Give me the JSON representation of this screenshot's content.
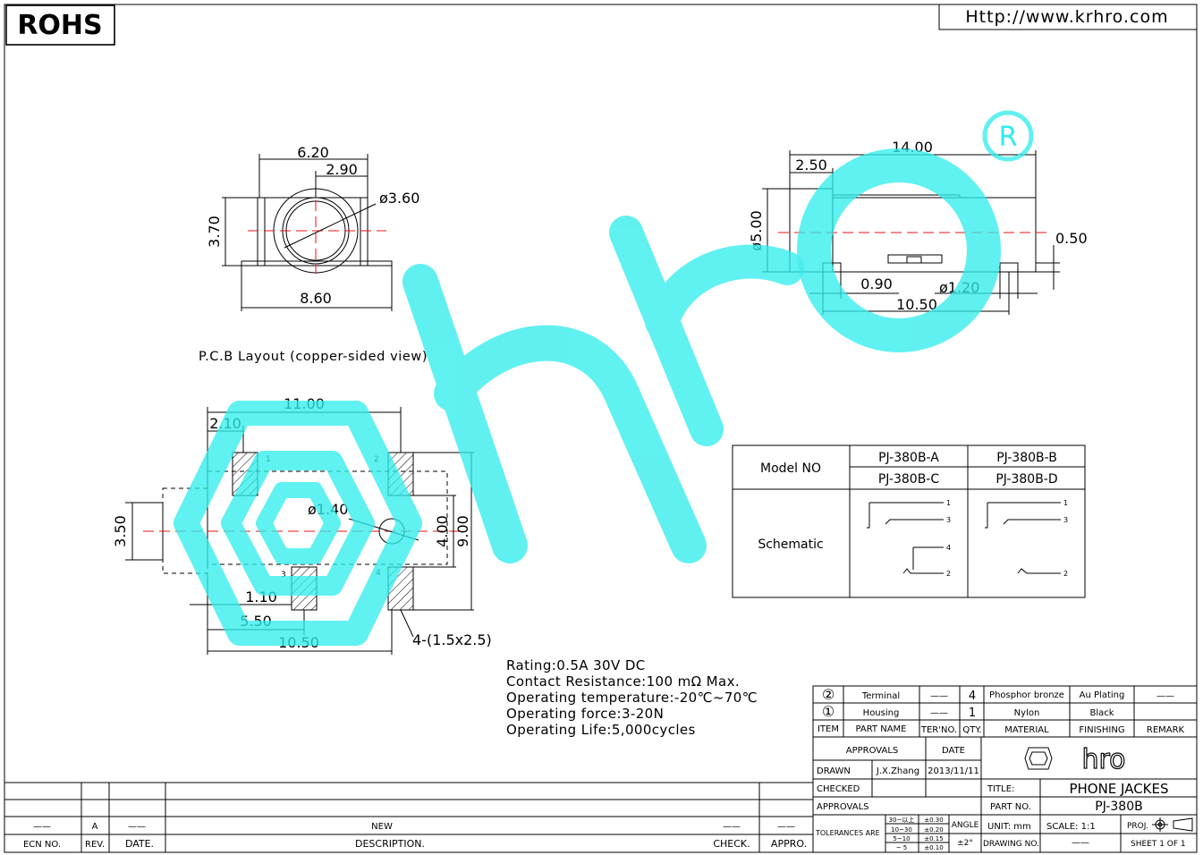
{
  "rohs": "ROHS",
  "url": "Http://www.krhro.com",
  "registered_mark": "R",
  "dims": {
    "front_width": "6.20",
    "front_offset": "2.90",
    "front_dia": "ø3.60",
    "front_height": "3.70",
    "front_base": "8.60",
    "side_len": "14.00",
    "side_head": "2.50",
    "side_dia": "ø5.00",
    "side_gap": "0.50",
    "side_pin": "0.90",
    "side_pin_dia": "ø1.20",
    "side_span": "10.50",
    "pcb_w": "11.00",
    "pcb_a": "2.10",
    "pcb_h1": "3.50",
    "pcb_dia": "ø1.40",
    "pcb_h2": "4.00",
    "pcb_h3": "9.00",
    "pcb_b": "1.10",
    "pcb_c": "5.50",
    "pcb_d": "10.50",
    "pcb_pad": "4-(1.5x2.5)"
  },
  "pcb_title": "P.C.B Layout (copper-sided view)",
  "pads": [
    "1",
    "2",
    "3",
    "4"
  ],
  "model_table": {
    "model_label": "Model NO",
    "models": [
      "PJ-380B-A",
      "PJ-380B-B",
      "PJ-380B-C",
      "PJ-380B-D"
    ],
    "schematic_label": "Schematic",
    "pins_left": [
      "1",
      "3",
      "4",
      "2"
    ],
    "pins_right": [
      "1",
      "3",
      "2"
    ]
  },
  "specs": [
    "Rating:0.5A 30V DC",
    "Contact Resistance:100 mΩ Max.",
    "Operating temperature:-20℃~70℃",
    "Operating force:3-20N",
    "Operating Life:5,000cycles"
  ],
  "bom": {
    "rows": [
      {
        "item": "②",
        "name": "Terminal",
        "ter": "——",
        "qty": "4",
        "material": "Phosphor bronze",
        "finish": "Au Plating",
        "remark": "——"
      },
      {
        "item": "①",
        "name": "Housing",
        "ter": "——",
        "qty": "1",
        "material": "Nylon",
        "finish": "Black",
        "remark": ""
      }
    ],
    "header": {
      "item": "ITEM",
      "name": "PART NAME",
      "ter": "TER'NO.",
      "qty": "QTY.",
      "material": "MATERIAL",
      "finish": "FINISHING",
      "remark": "REMARK"
    }
  },
  "title_block": {
    "approvals": "APPROVALS",
    "date": "DATE",
    "drawn": "DRAWN",
    "drawn_by": "J.X.Zhang",
    "drawn_date": "2013/11/11",
    "checked": "CHECKED",
    "approvals2": "APPROVALS",
    "logo": "hro",
    "title_label": "TITLE:",
    "title_value": "PHONE JACKES",
    "part_label": "PART NO.",
    "part_value": "PJ-380B",
    "tolerances": "TOLERANCES ARE",
    "tol_ranges": [
      "30~以上",
      "10~30",
      "5~10",
      "~ 5"
    ],
    "tol_values": [
      "±0.30",
      "±0.20",
      "±0.15",
      "±0.10"
    ],
    "angle": "ANGLE",
    "angle_value": "±2°",
    "unit": "UNIT: mm",
    "scale": "SCALE:  1:1",
    "proj": "PROJ.",
    "drawing_no": "DRAWING NO.",
    "drawing_no_value": "——",
    "sheet": "SHEET  1 OF 1"
  },
  "revision": {
    "row": {
      "ecn": "——",
      "rev": "A",
      "date": "——",
      "desc": "NEW",
      "check": "——",
      "appro": "——"
    },
    "header": {
      "ecn": "ECN NO.",
      "rev": "REV.",
      "date": "DATE.",
      "desc": "DESCRIPTION.",
      "check": "CHECK.",
      "appro": "APPRO."
    }
  },
  "colors": {
    "watermark": "#30ecec",
    "centerline": "#e11111"
  }
}
